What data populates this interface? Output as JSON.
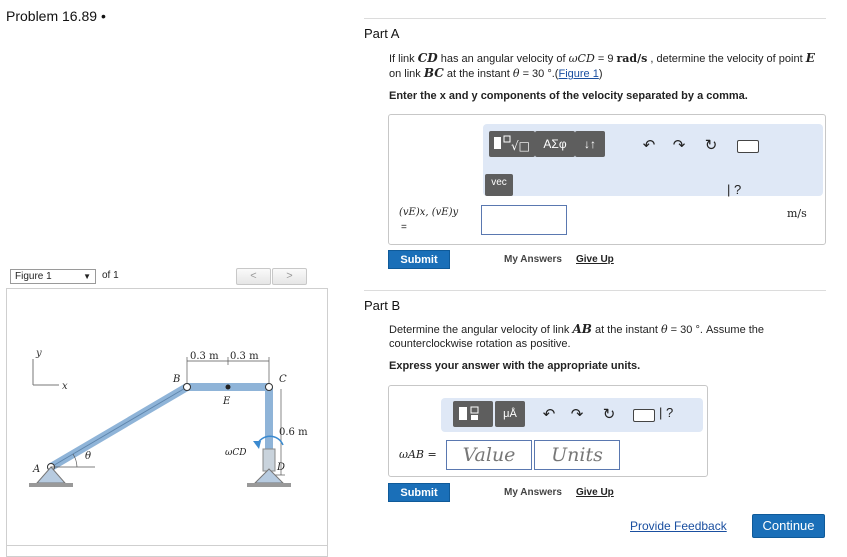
{
  "problem": {
    "title": "Problem 16.89 •"
  },
  "figure": {
    "select_value": "Figure 1",
    "of_label": "of 1",
    "prev": "<",
    "next": ">",
    "labels": {
      "y": "y",
      "x": "x",
      "A": "A",
      "B": "B",
      "C": "C",
      "D": "D",
      "E": "E",
      "theta": "θ",
      "dim1": "0.3 m",
      "dim2": "0.3 m",
      "dim3": "0.6 m",
      "omega": "ωCD"
    }
  },
  "partA": {
    "title": "Part A",
    "q1": "If link ",
    "link": "CD",
    "q2": " has an angular velocity of ",
    "omega": "ωCD",
    "q3": " = 9 ",
    "unit_rad": "rad/s",
    "q4": " , determine the velocity of point ",
    "pointE": "E",
    "q5": " on link ",
    "linkBC": "BC",
    "q6": " at the instant ",
    "theta": "θ",
    "q7": " = 30 °.(",
    "figlink": "Figure 1",
    "q8": ")",
    "instruction": "Enter the x and y components of the velocity separated by a comma.",
    "toolbar": {
      "greek": "ΑΣφ",
      "sort": "↓↑",
      "vec": "vec",
      "undo": "↶",
      "redo": "↷",
      "reset": "↻",
      "help": "| ?"
    },
    "label": "(vE)x, (vE)y",
    "label_eq": "=",
    "unit": "m/s",
    "input_value": "",
    "submit": "Submit",
    "my_answers": "My Answers",
    "give_up": "Give Up"
  },
  "partB": {
    "title": "Part B",
    "q1": "Determine the angular velocity of link ",
    "link": "AB",
    "q2": " at the instant ",
    "theta": "θ",
    "q3": " = 30 °. Assume the counterclockwise rotation as positive.",
    "instruction": "Express your answer with the appropriate units.",
    "toolbar": {
      "mu": "μÅ",
      "undo": "↶",
      "redo": "↷",
      "reset": "↻",
      "help": "| ?"
    },
    "label": "ωAB =",
    "value_placeholder": "Value",
    "units_placeholder": "Units",
    "submit": "Submit",
    "my_answers": "My Answers",
    "give_up": "Give Up"
  },
  "footer": {
    "feedback": "Provide Feedback",
    "continue": "Continue"
  },
  "colors": {
    "accent": "#1a6fb8",
    "link": "#1a4fa0",
    "toolbar_bg": "#dfe8f6",
    "link_bar": "#8fb4d8"
  }
}
